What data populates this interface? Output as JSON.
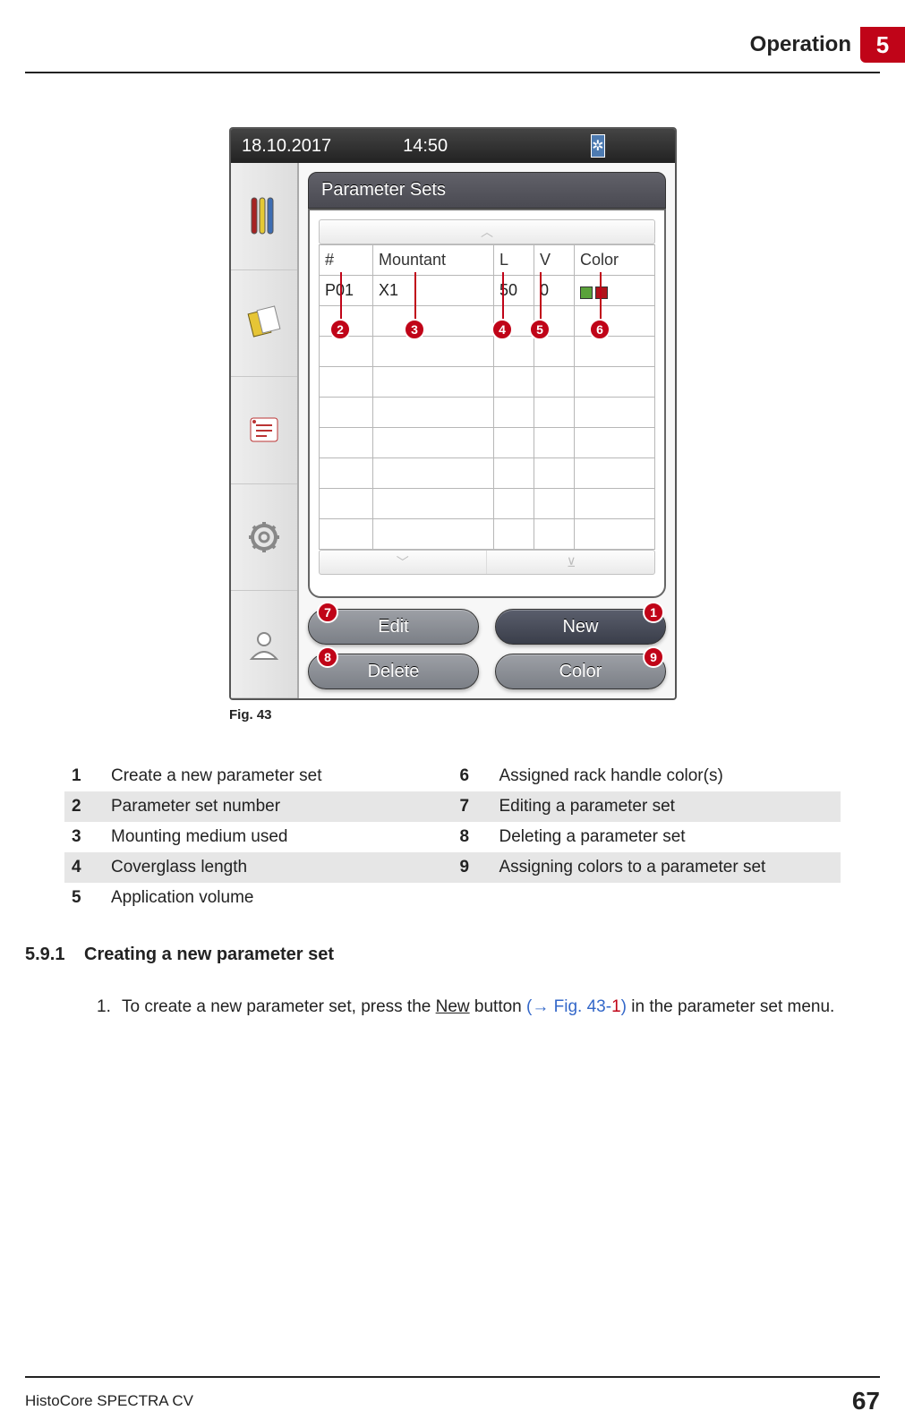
{
  "header": {
    "chapter_title": "Operation",
    "chapter_number": "5"
  },
  "device": {
    "status": {
      "date": "18.10.2017",
      "time": "14:50"
    },
    "panel_title": "Parameter Sets",
    "table": {
      "headers": {
        "num": "#",
        "mountant": "Mountant",
        "l": "L",
        "v": "V",
        "color": "Color"
      },
      "row1": {
        "num": "P01",
        "mountant": "X1",
        "l": "50",
        "v": "0"
      }
    },
    "buttons": {
      "edit": "Edit",
      "new": "New",
      "delete": "Delete",
      "color": "Color"
    }
  },
  "callouts": {
    "c1": "1",
    "c2": "2",
    "c3": "3",
    "c4": "4",
    "c5": "5",
    "c6": "6",
    "c7": "7",
    "c8": "8",
    "c9": "9"
  },
  "figure_caption": "Fig.  43",
  "legend": {
    "l1": {
      "n": "1",
      "t": "Create a new parameter set"
    },
    "l2": {
      "n": "2",
      "t": "Parameter set number"
    },
    "l3": {
      "n": "3",
      "t": "Mounting medium used"
    },
    "l4": {
      "n": "4",
      "t": "Coverglass length"
    },
    "l5": {
      "n": "5",
      "t": "Application volume"
    },
    "l6": {
      "n": "6",
      "t": "Assigned rack handle color(s)"
    },
    "l7": {
      "n": "7",
      "t": "Editing a parameter set"
    },
    "l8": {
      "n": "8",
      "t": "Deleting a parameter set"
    },
    "l9": {
      "n": "9",
      "t": "Assigning colors to a parameter set"
    }
  },
  "section": {
    "num": "5.9.1",
    "title": "Creating a new parameter set"
  },
  "body": {
    "step1_num": "1.",
    "step1_a": "To create a new parameter set, press the ",
    "step1_btn": "New",
    "step1_b": " button ",
    "step1_ref_open": "(→ Fig.  43",
    "step1_ref_dash": "-",
    "step1_ref_one": "1",
    "step1_ref_close": ")",
    "step1_c": " in the parameter set menu."
  },
  "footer": {
    "product": "HistoCore SPECTRA CV",
    "page": "67"
  }
}
